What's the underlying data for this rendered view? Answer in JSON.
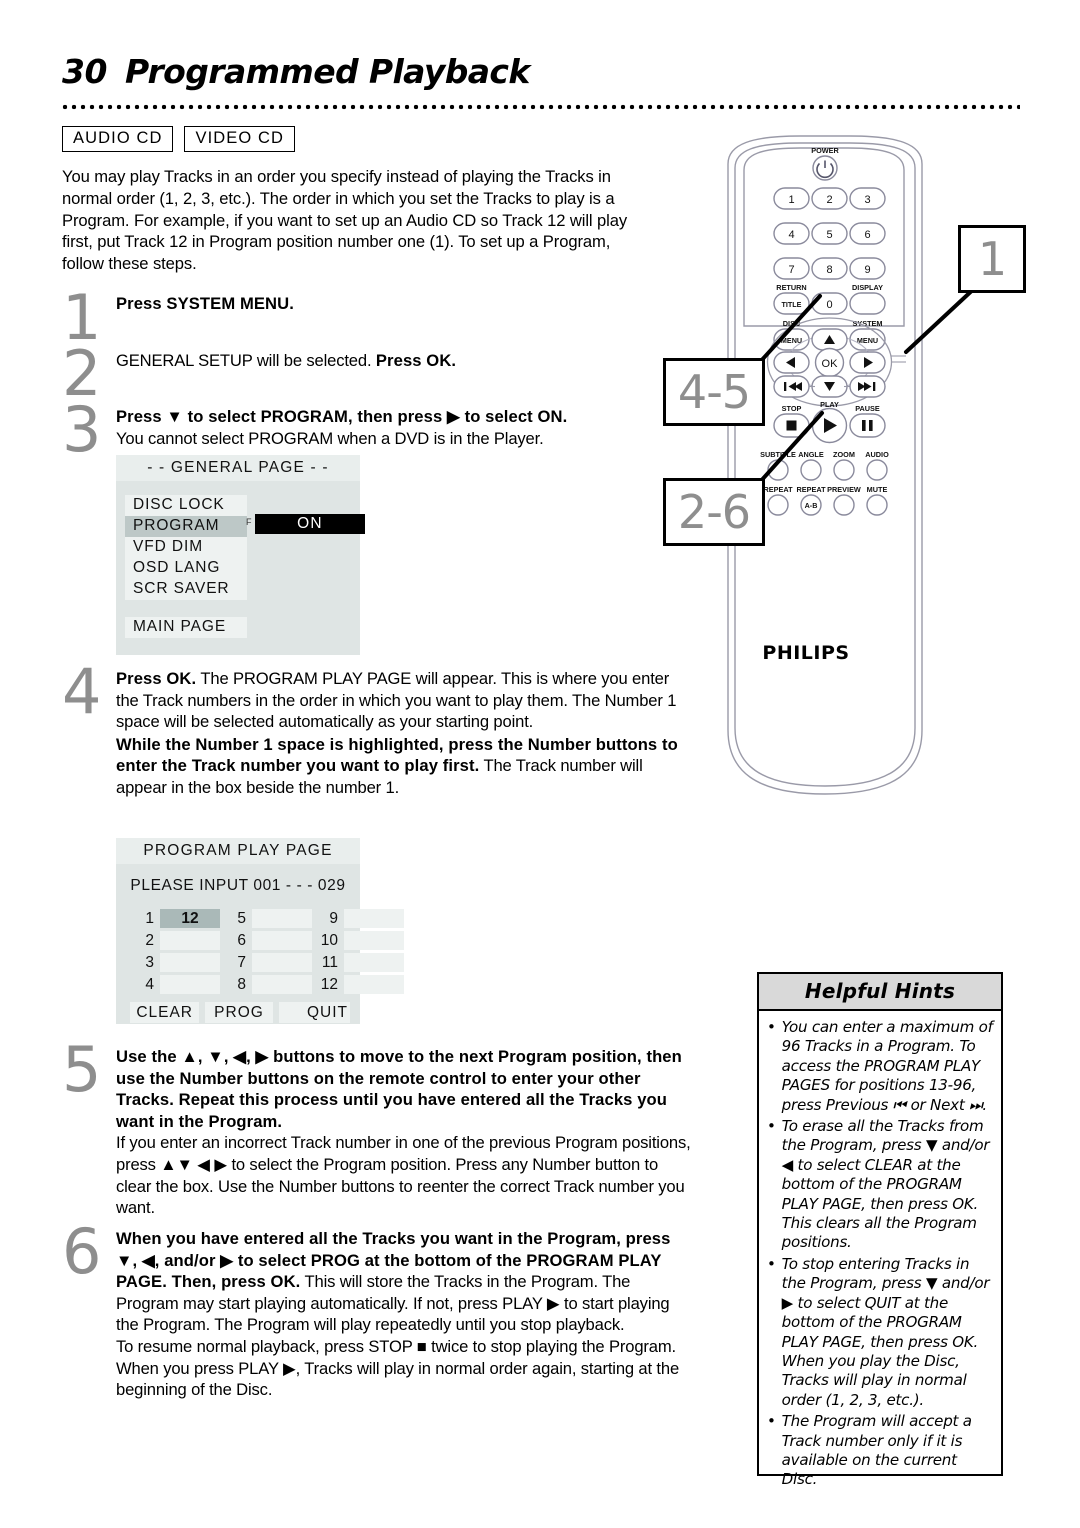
{
  "header": {
    "page_number": "30",
    "title": "Programmed Playback",
    "badges": [
      "AUDIO CD",
      "VIDEO CD"
    ]
  },
  "intro": "You may play Tracks in an order you specify instead of playing the Tracks in normal order (1, 2, 3, etc.). The order in which you set the Tracks to play is a Program. For example, if you want to set up an Audio CD so Track 12 will play first, put Track 12 in Program position number one (1). To set up a Program, follow these steps.",
  "steps": [
    {
      "num": "1",
      "bold": "Press SYSTEM MENU.",
      "rest": ""
    },
    {
      "num": "2",
      "lead_plain": "GENERAL SETUP will be selected. ",
      "bold": "Press OK.",
      "rest": ""
    },
    {
      "num": "3",
      "bold": "Press ▼ to select PROGRAM, then press ▶ to select ON.",
      "rest": "You cannot select PROGRAM when a DVD is in the Player."
    },
    {
      "num": "4",
      "bold": "Press OK.",
      "rest": " The PROGRAM PLAY PAGE will appear. This is where you enter the Track numbers in the order in which you want to play them. The Number 1 space will be selected automatically as your starting point.",
      "bold2": "While the Number 1 space is highlighted, press the Number buttons to enter the Track number you want to play first.",
      "rest2": " The Track number will appear in the box beside the number 1."
    },
    {
      "num": "5",
      "bold": "Use the ▲, ▼, ◀, ▶ buttons to move to the next Program position, then use the Number buttons on the remote control to enter your other Tracks. Repeat this process until you have entered all the Tracks you want in the Program.",
      "rest": "If you enter an incorrect Track number in one of the previous Program positions, press ▲▼ ◀ ▶ to select the Program position. Press any Number button to clear the box. Use the Number buttons to reenter the correct Track number you want."
    },
    {
      "num": "6",
      "bold": "When you have entered all the Tracks you want in the Program, press ▼, ◀, and/or ▶ to select PROG at the bottom of the PROGRAM PLAY PAGE. Then, press OK.",
      "rest": " This will store the Tracks in the Program. The Program may start playing automatically. If not, press PLAY ▶ to start playing the Program. The Program will play repeatedly until you stop playback.",
      "rest2": "To resume normal playback, press STOP ■ twice to stop playing the Program. When you press PLAY ▶, Tracks will play in normal order again, starting at the beginning of the Disc."
    }
  ],
  "general_page": {
    "title": "- -  GENERAL PAGE  - -",
    "rows": [
      "DISC LOCK",
      "PROGRAM",
      "VFD DIM",
      "OSD LANG",
      "SCR SAVER"
    ],
    "selected_row": "PROGRAM",
    "value": "ON",
    "value_flag": "F",
    "footer_row": "MAIN PAGE"
  },
  "program_play_page": {
    "title": "PROGRAM PLAY PAGE",
    "prompt": "PLEASE INPUT 001 - - - 029",
    "slots": [
      {
        "index": "1",
        "value": "12",
        "highlighted": true
      },
      {
        "index": "2",
        "value": "",
        "highlighted": false
      },
      {
        "index": "3",
        "value": "",
        "highlighted": false
      },
      {
        "index": "4",
        "value": "",
        "highlighted": false
      },
      {
        "index": "5",
        "value": "",
        "highlighted": false
      },
      {
        "index": "6",
        "value": "",
        "highlighted": false
      },
      {
        "index": "7",
        "value": "",
        "highlighted": false
      },
      {
        "index": "8",
        "value": "",
        "highlighted": false
      },
      {
        "index": "9",
        "value": "",
        "highlighted": false
      },
      {
        "index": "10",
        "value": "",
        "highlighted": false
      },
      {
        "index": "11",
        "value": "",
        "highlighted": false
      },
      {
        "index": "12",
        "value": "",
        "highlighted": false
      }
    ],
    "buttons": [
      "CLEAR",
      "PROG",
      "QUIT"
    ]
  },
  "remote": {
    "brand": "PHILIPS",
    "power_label": "POWER",
    "number_keys": [
      "1",
      "2",
      "3",
      "4",
      "5",
      "6",
      "7",
      "8",
      "9",
      "0"
    ],
    "labels": {
      "return": "RETURN",
      "title": "TITLE",
      "display": "DISPLAY",
      "disc": "DISC",
      "disc_menu": "MENU",
      "system": "SYSTEM",
      "system_menu": "MENU",
      "ok": "OK",
      "stop": "STOP",
      "play": "PLAY",
      "pause": "PAUSE"
    },
    "bottom_row1": [
      "SUBTITLE",
      "ANGLE",
      "ZOOM",
      "AUDIO"
    ],
    "bottom_row2": [
      "REPEAT",
      "REPEAT",
      "PREVIEW",
      "MUTE"
    ],
    "repeat_ab": "A-B"
  },
  "callouts": [
    {
      "label": "1"
    },
    {
      "label": "4-5"
    },
    {
      "label": "2-6"
    }
  ],
  "hints": {
    "title": "Helpful Hints",
    "items": [
      "You can enter a maximum of 96 Tracks in a Program. To access the PROGRAM PLAY PAGES for positions 13-96, press Previous ⏮ or Next ⏭.",
      "To erase all the Tracks from the Program, press ▼ and/or ◀ to select CLEAR at the bottom of the PROGRAM PLAY PAGE, then press OK. This clears all the Program positions.",
      "To stop entering Tracks in the Program, press ▼ and/or ▶ to select QUIT at the bottom of the PROGRAM PLAY PAGE, then press OK. When you play the Disc, Tracks will play in normal order (1, 2, 3, etc.).",
      "The Program will accept a Track number only if it is available on the current Disc."
    ]
  },
  "colors": {
    "step_number": "#8e8e8e",
    "osd_background": "#dfe5e4",
    "osd_row": "#eef2f1",
    "osd_selected": "#bdc8c7",
    "hints_header": "#d9d9d9"
  }
}
